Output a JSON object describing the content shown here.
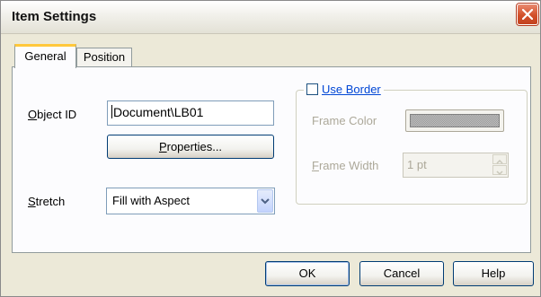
{
  "window": {
    "title": "Item Settings",
    "close_icon": "close-icon"
  },
  "tabs": [
    {
      "label": "General",
      "active": true
    },
    {
      "label": "Position",
      "active": false
    }
  ],
  "object_id": {
    "label": "Object ID",
    "mnemonic": "O",
    "label_rest": "bject ID",
    "value": "Document\\LB01"
  },
  "properties_button": {
    "label": "Properties...",
    "mnemonic": "P",
    "label_rest": "roperties..."
  },
  "stretch": {
    "label": "Stretch",
    "mnemonic": "S",
    "label_rest": "tretch",
    "selected": "Fill with Aspect"
  },
  "border_group": {
    "checkbox_label": "Use Border",
    "mnemonic": "U",
    "label_rest": "se Border",
    "checked": false,
    "frame_color_label": "Frame Color",
    "frame_width_label": "Frame Width",
    "frame_width_mnemonic": "F",
    "frame_width_rest": "rame Width",
    "frame_width_value": "1 pt",
    "enabled": false
  },
  "footer": {
    "ok_label": "OK",
    "cancel_label": "Cancel",
    "help_label": "Help"
  },
  "colors": {
    "dialog_bg": "#ece9d8",
    "panel_bg": "#fcfcfe",
    "tab_highlight": "#ffc83c",
    "close_button": "#d2502a",
    "link_blue": "#0046d5",
    "disabled_text": "#aca899"
  }
}
